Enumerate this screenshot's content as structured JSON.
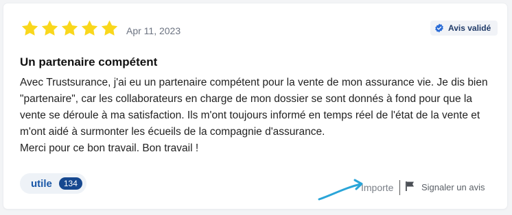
{
  "review": {
    "rating": 5,
    "rating_max": 5,
    "star_color": "#f9d71c",
    "date": "Apr 11, 2023",
    "verified_label": "Avis validé",
    "verified_icon": "verified-check-icon",
    "title": "Un partenaire compétent",
    "body": [
      "Avec Trustsurance, j'ai eu un partenaire compétent pour la vente de mon assurance vie. Je dis bien \"partenaire\", car les collaborateurs en charge de mon dossier se sont donnés à fond pour que la vente se déroule à ma satisfaction. Ils m'ont toujours informé en temps réel de l'état de la vente et m'ont aidé à surmonter les écueils de la compagnie d'assurance.",
      "Merci pour ce bon travail. Bon travail !"
    ]
  },
  "actions": {
    "useful_label": "utile",
    "useful_count": "134",
    "import_label": "Importe",
    "report_label": "Signaler un avis",
    "report_icon": "flag-icon"
  },
  "colors": {
    "accent": "#1a57a7",
    "count_badge": "#16488f",
    "arrow": "#2aa5d8"
  }
}
